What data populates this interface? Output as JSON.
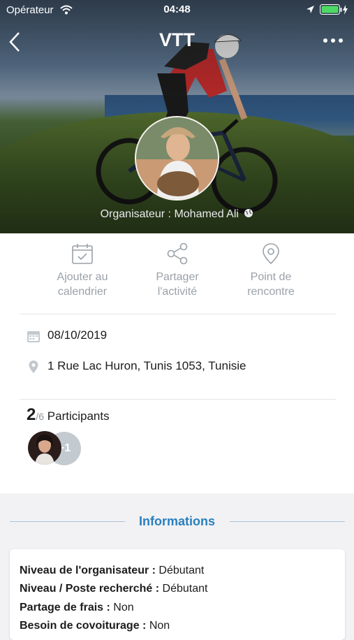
{
  "status_bar": {
    "carrier": "Opérateur",
    "time": "04:48"
  },
  "header": {
    "title": "VTT",
    "organizer": "Organisateur : Mohamed Ali"
  },
  "actions": [
    {
      "line1": "Ajouter au",
      "line2": "calendrier",
      "icon": "calendar-icon"
    },
    {
      "line1": "Partager",
      "line2": "l'activité",
      "icon": "share-icon"
    },
    {
      "line1": "Point de",
      "line2": "rencontre",
      "icon": "map-pin-icon"
    }
  ],
  "details": {
    "date": "08/10/2019",
    "address": "1 Rue Lac Huron, Tunis 1053, Tunisie"
  },
  "participants": {
    "count": "2",
    "max": "/6",
    "label": "Participants",
    "extra": "+1"
  },
  "informations": {
    "title": "Informations",
    "items": [
      {
        "label": "Niveau de l'organisateur :",
        "value": "Débutant"
      },
      {
        "label": "Niveau / Poste recherché :",
        "value": "Débutant"
      },
      {
        "label": "Partage de frais :",
        "value": "Non"
      },
      {
        "label": "Besoin de covoiturage :",
        "value": "Non"
      }
    ]
  },
  "colors": {
    "accent": "#2a7fbd",
    "muted": "#9aa1a8"
  }
}
